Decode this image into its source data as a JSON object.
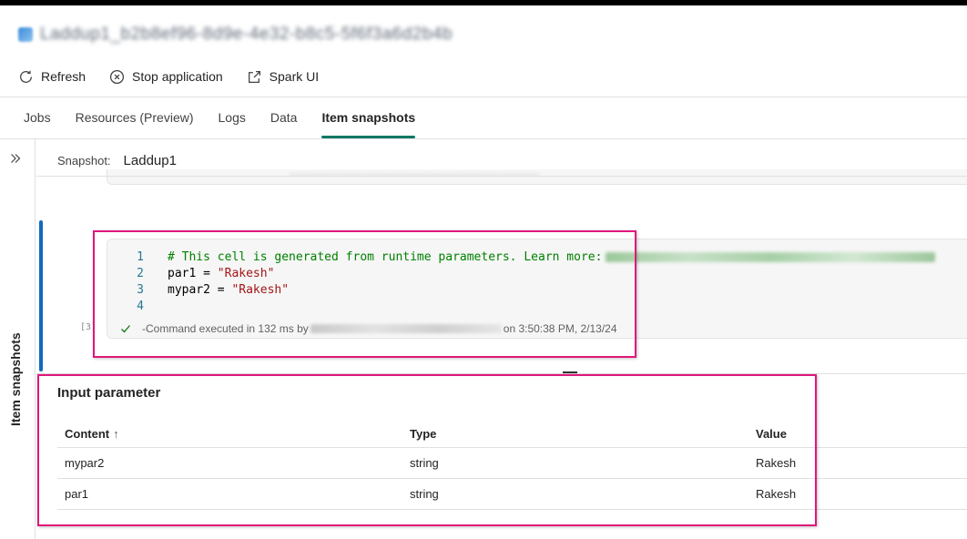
{
  "window": {
    "title": "Laddup1_b2b8ef96-8d9e-4e32-b8c5-5f6f3a6d2b4b"
  },
  "toolbar": {
    "refresh_label": "Refresh",
    "stop_label": "Stop application",
    "spark_label": "Spark UI"
  },
  "tabs": [
    {
      "label": "Jobs"
    },
    {
      "label": "Resources (Preview)"
    },
    {
      "label": "Logs"
    },
    {
      "label": "Data"
    },
    {
      "label": "Item snapshots",
      "active": true
    }
  ],
  "side_panel": {
    "label": "Item snapshots"
  },
  "snapshot": {
    "label": "Snapshot:",
    "value": "Laddup1"
  },
  "code_cell": {
    "lines": [
      {
        "num": "1",
        "comment": "# This cell is generated from runtime parameters. Learn more:"
      },
      {
        "num": "2",
        "var": "par1",
        "op": " = ",
        "value": "\"Rakesh\""
      },
      {
        "num": "3",
        "var": "mypar2",
        "op": " = ",
        "value": "\"Rakesh\""
      },
      {
        "num": "4"
      }
    ],
    "exec_count": "[3]",
    "status_prefix": "-Command executed in 132 ms by",
    "status_suffix": "on 3:50:38 PM, 2/13/24"
  },
  "input_parameters": {
    "title": "Input parameter",
    "columns": {
      "content": "Content",
      "sort_arrow": "↑",
      "type": "Type",
      "value": "Value"
    },
    "rows": [
      {
        "content": "mypar2",
        "type": "string",
        "value": "Rakesh"
      },
      {
        "content": "par1",
        "type": "string",
        "value": "Rakesh"
      }
    ]
  },
  "colors": {
    "accent": "#117865",
    "highlight": "#e0177a",
    "cell_bar": "#0f6cbd",
    "comment": "#008000",
    "string": "#a31515"
  },
  "icons": [
    "refresh-icon",
    "stop-circle-icon",
    "external-link-icon",
    "expand-chevron-icon",
    "check-icon"
  ]
}
